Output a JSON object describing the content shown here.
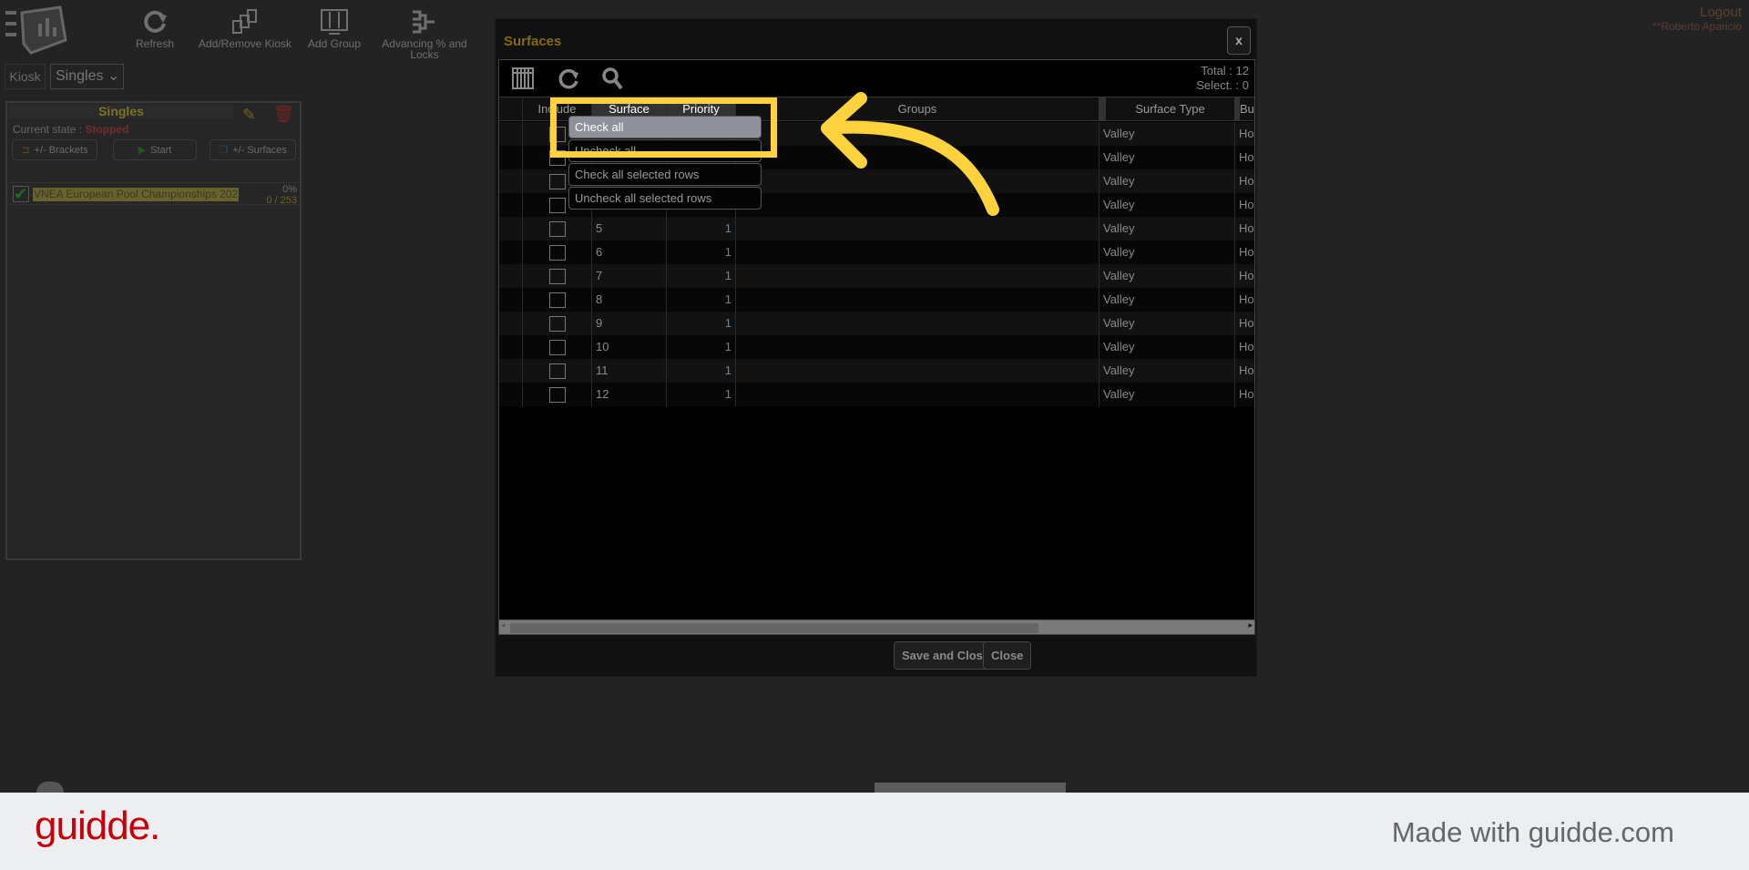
{
  "toolbar": {
    "items": [
      {
        "label": "Refresh",
        "icon": "refresh-icon"
      },
      {
        "label": "Add/Remove Kiosk",
        "icon": "kiosk-icon"
      },
      {
        "label": "Add Group",
        "icon": "group-icon"
      },
      {
        "label": "Advancing % and Locks",
        "icon": "bracket-icon"
      }
    ]
  },
  "user": {
    "logout": "Logout",
    "name": "**Roberto Aparicio"
  },
  "kiosk": {
    "label": "Kiosk",
    "selected": "Singles"
  },
  "panel": {
    "title": "Singles",
    "state_label": "Current state :",
    "state_value": "Stopped",
    "brackets_btn": "+/- Brackets",
    "start_btn": "Start",
    "surfaces_btn": "+/- Surfaces",
    "event_name": "VNEA European Pool Championships 202",
    "event_pct": "0%",
    "event_count": "0 / 253"
  },
  "modal": {
    "title": "Surfaces",
    "close_x": "x",
    "total": "Total : 12",
    "selected": "Select. : 0",
    "columns": [
      "Include",
      "Surface",
      "Priority",
      "Groups",
      "Surface Type",
      "Bui"
    ],
    "rows": [
      {
        "surface": "",
        "priority": "",
        "type": "Valley",
        "bui": "Ho"
      },
      {
        "surface": "",
        "priority": "",
        "type": "Valley",
        "bui": "Ho"
      },
      {
        "surface": "",
        "priority": "",
        "type": "Valley",
        "bui": "Ho"
      },
      {
        "surface": "",
        "priority": "",
        "type": "Valley",
        "bui": "Ho"
      },
      {
        "surface": "5",
        "priority": "1",
        "type": "Valley",
        "bui": "Ho"
      },
      {
        "surface": "6",
        "priority": "1",
        "type": "Valley",
        "bui": "Ho"
      },
      {
        "surface": "7",
        "priority": "1",
        "type": "Valley",
        "bui": "Ho"
      },
      {
        "surface": "8",
        "priority": "1",
        "type": "Valley",
        "bui": "Ho"
      },
      {
        "surface": "9",
        "priority": "1",
        "type": "Valley",
        "bui": "Ho"
      },
      {
        "surface": "10",
        "priority": "1",
        "type": "Valley",
        "bui": "Ho"
      },
      {
        "surface": "11",
        "priority": "1",
        "type": "Valley",
        "bui": "Ho"
      },
      {
        "surface": "12",
        "priority": "1",
        "type": "Valley",
        "bui": "Ho"
      }
    ],
    "menu": [
      "Check all",
      "Uncheck all",
      "Check all selected rows",
      "Uncheck all selected rows"
    ],
    "save_close": "Save and Close",
    "close": "Close"
  },
  "banner": {
    "brand": "guidde.",
    "made_with": "Made with guidde.com"
  },
  "colors": {
    "highlight": "#fdd23c",
    "brand": "#c8000a",
    "title": "#85690e"
  }
}
